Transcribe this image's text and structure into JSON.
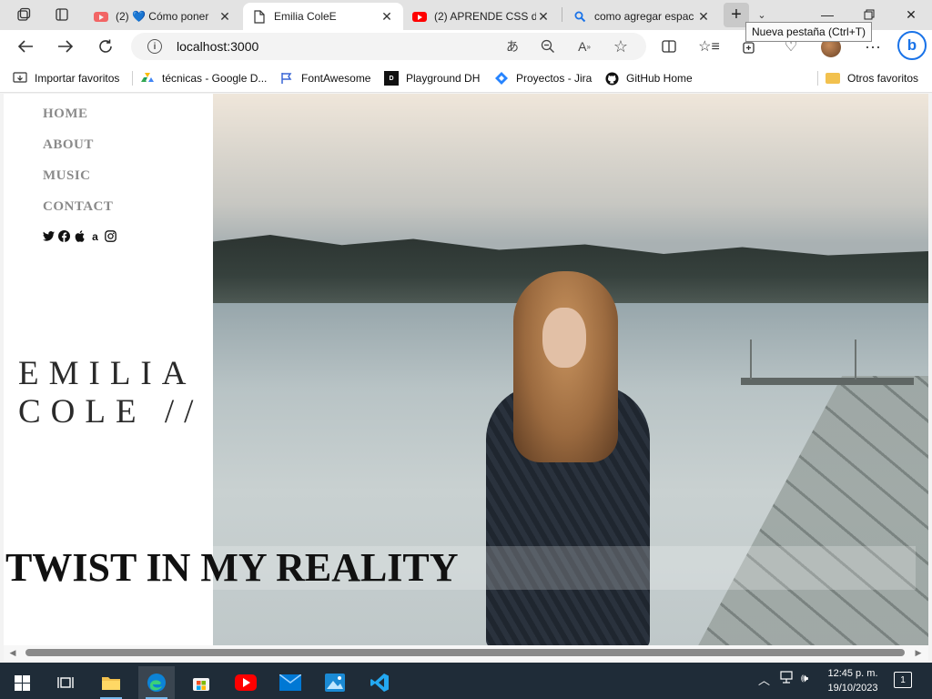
{
  "browser": {
    "tabs": [
      {
        "title": "(2) 💙 Cómo poner",
        "favicon": "youtube-icon",
        "active": false
      },
      {
        "title": "Emilia ColeE",
        "favicon": "page-icon",
        "active": true
      },
      {
        "title": "(2) APRENDE CSS de",
        "favicon": "youtube-icon",
        "active": false
      },
      {
        "title": "como agregar espac",
        "favicon": "search-icon",
        "active": false
      }
    ],
    "tooltip": "Nueva pestaña (Ctrl+T)",
    "address": {
      "url": "localhost:3000"
    },
    "favorites": [
      {
        "label": "Importar favoritos",
        "icon": "import-icon"
      },
      {
        "label": "técnicas - Google D...",
        "icon": "google-drive-icon"
      },
      {
        "label": "FontAwesome",
        "icon": "flag-icon"
      },
      {
        "label": "Playground DH",
        "icon": "dh-icon"
      },
      {
        "label": "Proyectos - Jira",
        "icon": "jira-icon"
      },
      {
        "label": "GitHub Home",
        "icon": "github-icon"
      }
    ],
    "other_favorites": "Otros favoritos"
  },
  "page": {
    "menu": [
      "HOME",
      "ABOUT",
      "MUSIC",
      "CONTACT"
    ],
    "social": [
      "twitter-icon",
      "facebook-icon",
      "apple-icon",
      "amazon-icon",
      "instagram-icon"
    ],
    "brand_line1": "EMILIA",
    "brand_line2": "COLE //",
    "headline": "TWIST IN MY REALITY"
  },
  "taskbar": {
    "time": "12:45 p. m.",
    "date": "19/10/2023",
    "notifications": "1"
  }
}
